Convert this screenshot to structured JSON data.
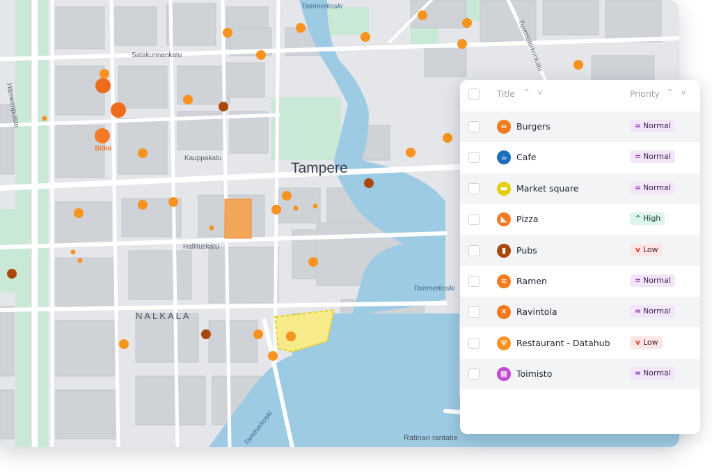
{
  "map": {
    "city_label": "Tampere",
    "district_label": "NALKALA",
    "street_labels": {
      "satakunnankatu": "Satakunnankatu",
      "kauppakatu": "Kauppakatu",
      "hallituskatu": "Hallituskatu",
      "hameenpuisto": "Hämeenpuisto",
      "tuomiokirkonkatu": "Tuomiokirkonkatu",
      "ratinan_rantatie": "Ratinan rantatie"
    },
    "water_labels": {
      "top": "Tammerkoski",
      "right": "Tammerkoski",
      "bottom": "Tammerkoski"
    },
    "poi_label": "Sitko",
    "colors": {
      "water": "#9ecbe4",
      "park": "#c9e8d6",
      "block": "#cfd3d8",
      "road": "#ffffff",
      "poi": "#f7931e",
      "poi_dark": "#f06c1d",
      "pub": "#a9480a",
      "highlight": "#f2a65a",
      "yellow_area": "#f7ea8a"
    }
  },
  "table": {
    "columns": {
      "title": "Title",
      "priority": "Priority"
    },
    "sort_indicator": "^ v",
    "rows": [
      {
        "title": "Burgers",
        "priority": "Normal",
        "priority_icon": "=",
        "icon": "burger-icon",
        "icon_glyph": "≡",
        "icon_color": "#f07a1d"
      },
      {
        "title": "Cafe",
        "priority": "Normal",
        "priority_icon": "=",
        "icon": "coffee-icon",
        "icon_glyph": "☕",
        "icon_color": "#1b6fb8"
      },
      {
        "title": "Market square",
        "priority": "Normal",
        "priority_icon": "=",
        "icon": "market-icon",
        "icon_glyph": "▬",
        "icon_color": "#e2cf12"
      },
      {
        "title": "Pizza",
        "priority": "High",
        "priority_icon": "^",
        "icon": "pizza-icon",
        "icon_glyph": "◣",
        "icon_color": "#f47a26"
      },
      {
        "title": "Pubs",
        "priority": "Low",
        "priority_icon": "v",
        "icon": "beer-icon",
        "icon_glyph": "▮",
        "icon_color": "#a9480a"
      },
      {
        "title": "Ramen",
        "priority": "Normal",
        "priority_icon": "=",
        "icon": "ramen-icon",
        "icon_glyph": "≋",
        "icon_color": "#f27c1e"
      },
      {
        "title": "Ravintola",
        "priority": "Normal",
        "priority_icon": "=",
        "icon": "restaurant-icon",
        "icon_glyph": "✕",
        "icon_color": "#f07a1d"
      },
      {
        "title": "Restaurant - Datahub",
        "priority": "Low",
        "priority_icon": "v",
        "icon": "cutlery-icon",
        "icon_glyph": "Ψ",
        "icon_color": "#f7931e"
      },
      {
        "title": "Toimisto",
        "priority": "Normal",
        "priority_icon": "=",
        "icon": "office-icon",
        "icon_glyph": "▦",
        "icon_color": "#c24ad0"
      }
    ]
  }
}
